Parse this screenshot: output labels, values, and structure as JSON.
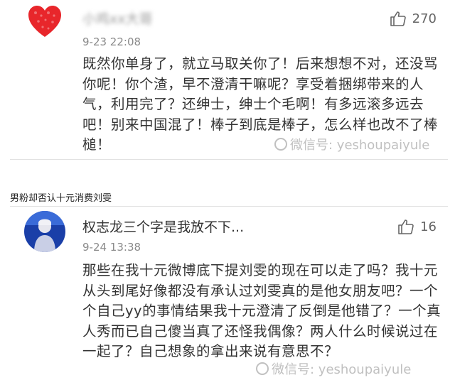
{
  "comments": [
    {
      "username": "小鸡xx大哥",
      "time": "9-23 22:08",
      "likes": "270",
      "text": "既然你单身了，就立马取关你了！后来想想不对，还没骂你呢！你个渣，早不澄清干嘛呢？享受着捆绑带来的人气，利用完了？还绅士，绅士个毛啊！有多远滚多远去吧！别来中国混了！棒子到底是棒子，怎么样也改不了棒槌！",
      "avatar_icon": "red-heart-avatar"
    },
    {
      "username": "权志龙三个字是我放不下...",
      "time": "9-24 13:38",
      "likes": "16",
      "text": "那些在我十元微博底下提刘雯的现在可以走了吗？我十元从头到尾好像都没有承认过刘雯真的是他女朋友吧？一个个自己yy的事情结果我十元澄清了反倒是他错了？一个真人秀而已自己傻当真了还怪我偶像？两人什么时候说过在一起了？自己想象的拿出来说有意思不？",
      "avatar_icon": "blue-portrait-avatar"
    }
  ],
  "section_label": "男粉却否认十元消费刘雯",
  "watermark": "微信号: yeshoupaiyule",
  "colors": {
    "heart": "#e8262b",
    "avatar_bg": "#1a3fa8"
  }
}
